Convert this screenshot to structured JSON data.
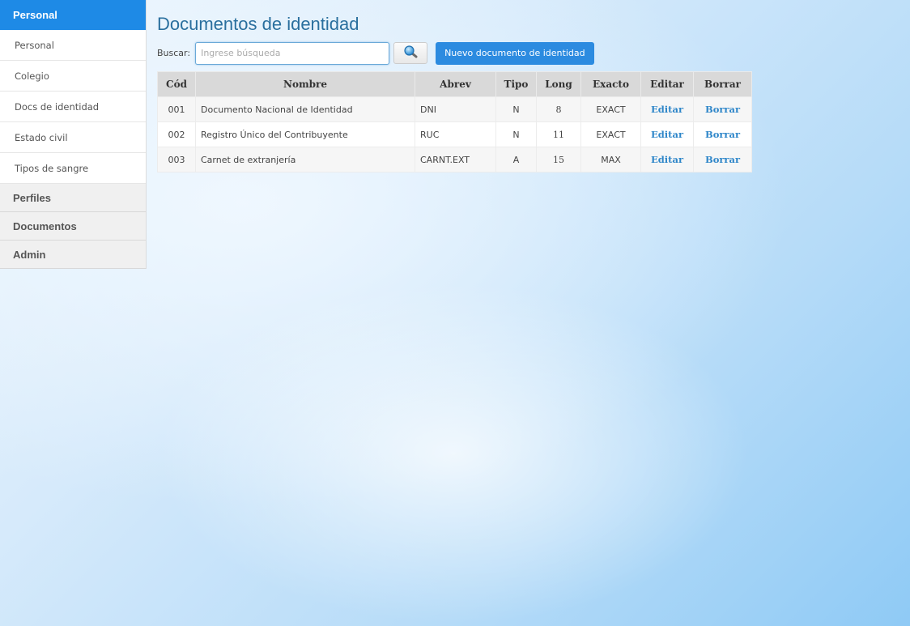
{
  "sidebar": {
    "header": "Personal",
    "items": [
      {
        "label": "Personal"
      },
      {
        "label": "Colegio"
      },
      {
        "label": "Docs de identidad"
      },
      {
        "label": "Estado civil"
      },
      {
        "label": "Tipos de sangre"
      }
    ],
    "sections": [
      {
        "label": "Perfiles"
      },
      {
        "label": "Documentos"
      },
      {
        "label": "Admin"
      }
    ]
  },
  "main": {
    "title": "Documentos de identidad",
    "search": {
      "label": "Buscar:",
      "value": "",
      "placeholder": "Ingrese búsqueda",
      "button_icon": "search-icon"
    },
    "new_button": "Nuevo documento de identidad",
    "table": {
      "columns": [
        "Cód",
        "Nombre",
        "Abrev",
        "Tipo",
        "Long",
        "Exacto",
        "Editar",
        "Borrar"
      ],
      "rows": [
        {
          "cod": "001",
          "nombre": "Documento Nacional de Identidad",
          "abrev": "DNI",
          "tipo": "N",
          "long": "8",
          "exacto": "EXACT",
          "editar": "Editar",
          "borrar": "Borrar"
        },
        {
          "cod": "002",
          "nombre": "Registro Único del Contribuyente",
          "abrev": "RUC",
          "tipo": "N",
          "long": "11",
          "exacto": "EXACT",
          "editar": "Editar",
          "borrar": "Borrar"
        },
        {
          "cod": "003",
          "nombre": "Carnet de extranjería",
          "abrev": "CARNT.EXT",
          "tipo": "A",
          "long": "15",
          "exacto": "MAX",
          "editar": "Editar",
          "borrar": "Borrar"
        }
      ]
    }
  },
  "colors": {
    "accent": "#1e8ae6",
    "title": "#2a6f9e",
    "link": "#2e86c9",
    "header_bg": "#d9d9d9"
  }
}
